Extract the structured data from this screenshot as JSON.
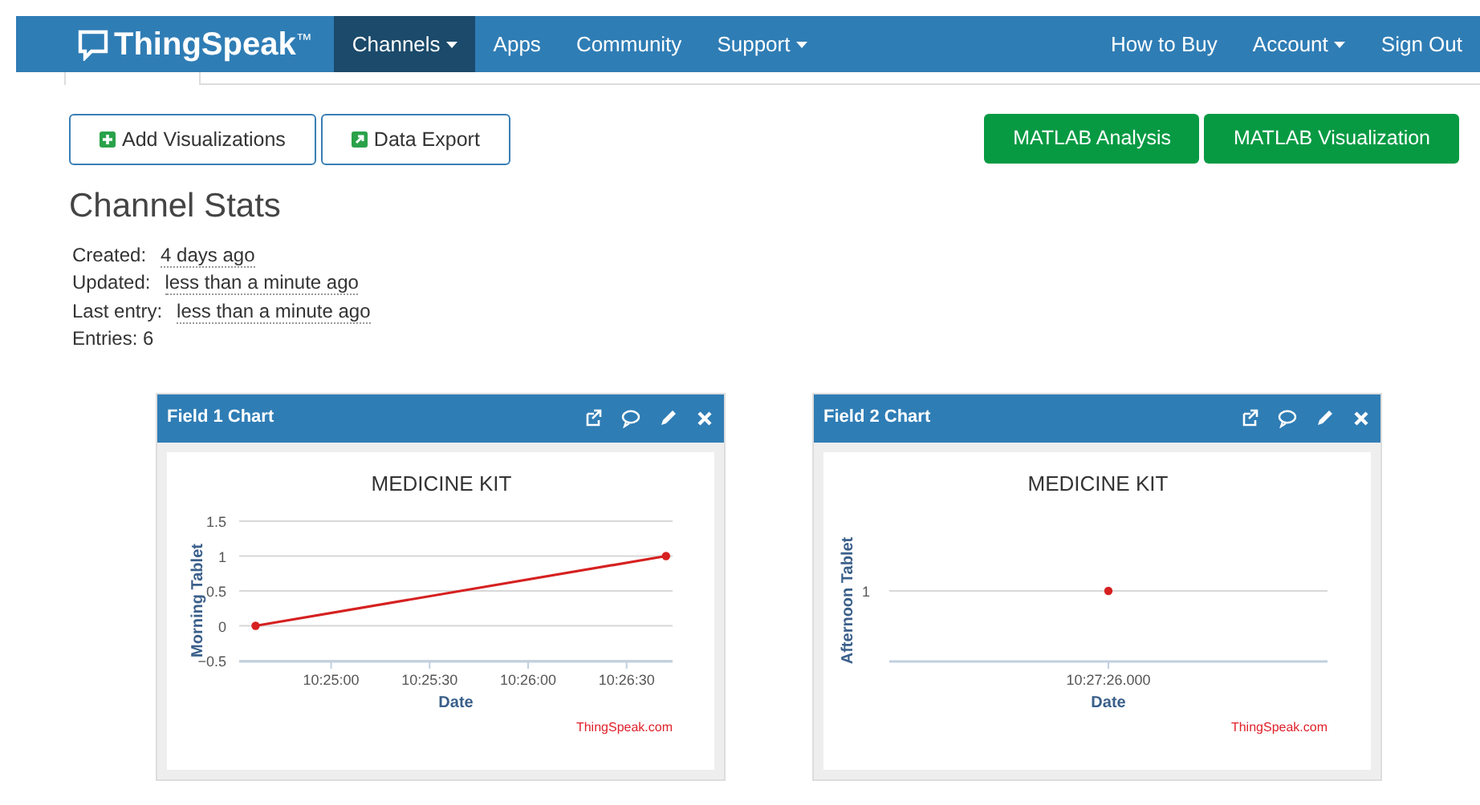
{
  "navbar": {
    "brand": "ThingSpeak",
    "brand_mark": "™",
    "left_items": [
      {
        "label": "Channels",
        "selected": true,
        "dropdown": true
      },
      {
        "label": "Apps",
        "selected": false,
        "dropdown": false
      },
      {
        "label": "Community",
        "selected": false,
        "dropdown": false
      },
      {
        "label": "Support",
        "selected": false,
        "dropdown": true
      }
    ],
    "right_items": [
      {
        "label": "How to Buy",
        "selected": false,
        "dropdown": false
      },
      {
        "label": "Account",
        "selected": false,
        "dropdown": true
      },
      {
        "label": "Sign Out",
        "selected": false,
        "dropdown": false
      }
    ]
  },
  "toolbar": {
    "left_buttons": [
      {
        "label": "Add Visualizations",
        "kind": "plus"
      },
      {
        "label": "Data Export",
        "kind": "export"
      }
    ],
    "right_buttons": [
      "MATLAB Analysis",
      "MATLAB Visualization"
    ]
  },
  "channel_stats": {
    "title": "Channel Stats",
    "rows": [
      {
        "label": "Created:",
        "value": "4 days ago"
      },
      {
        "label": "Updated:",
        "value": "less than a minute ago"
      },
      {
        "label": "Last entry:",
        "value": "less than a minute ago"
      },
      {
        "label": "Entries: 6"
      }
    ]
  },
  "charts": [
    {
      "title": "Field 1 Chart",
      "credit": "ThingSpeak.com",
      "chart_data": {
        "type": "line",
        "title": "MEDICINE KIT",
        "xlabel": "Date",
        "ylabel": "Morning Tablet",
        "grid": true,
        "x": [
          37477,
          37602
        ],
        "series": [
          {
            "color": "#d62020",
            "marker": "circle",
            "values": [
              0,
              1
            ]
          }
        ],
        "xlim": [
          37472,
          37604
        ],
        "ylim": [
          -0.5,
          1.5
        ],
        "xticks": [
          {
            "value": 37500,
            "label": "10:25:00"
          },
          {
            "value": 37530,
            "label": "10:25:30"
          },
          {
            "value": 37560,
            "label": "10:26:00"
          },
          {
            "value": 37590,
            "label": "10:26:30"
          }
        ],
        "yticks": [
          {
            "value": -0.5,
            "label": "−0.5"
          },
          {
            "value": 0,
            "label": "0"
          },
          {
            "value": 0.5,
            "label": "0.5"
          },
          {
            "value": 1,
            "label": "1"
          },
          {
            "value": 1.5,
            "label": "1.5"
          }
        ]
      }
    },
    {
      "title": "Field 2 Chart",
      "credit": "ThingSpeak.com",
      "plot": {
        "title": "MEDICINE KIT",
        "xlabel": "Date",
        "ylabel": "Afternoon Tablet",
        "y_tick": "1",
        "x_tick": "10:27:26.000"
      }
    }
  ]
}
